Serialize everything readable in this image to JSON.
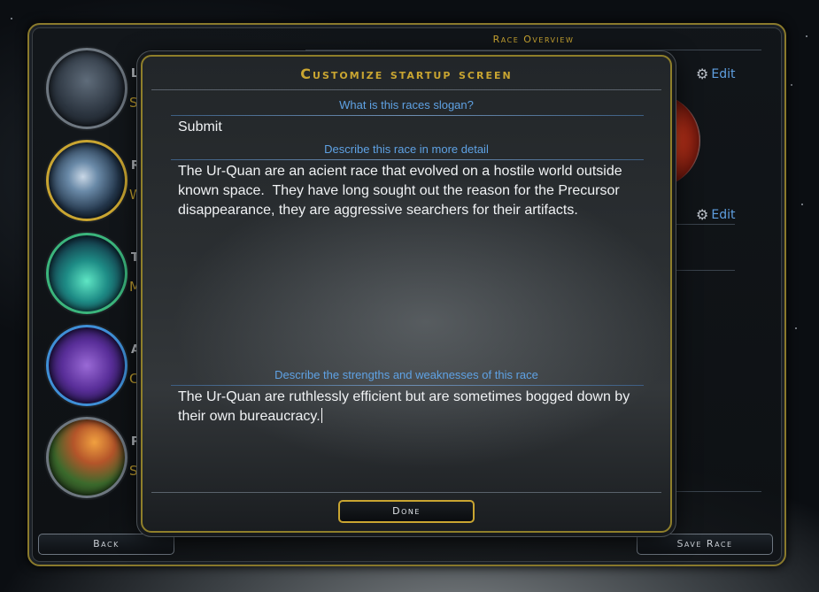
{
  "overview": {
    "title": "Race Overview",
    "edit_label_1": "Edit",
    "edit_label_2": "Edit"
  },
  "sidebar": {
    "items": [
      {
        "letter": "Le",
        "subtext": "Se",
        "icon": "leader-portrait-icon"
      },
      {
        "letter": "R",
        "subtext": "W",
        "icon": "race-planet-icon"
      },
      {
        "letter": "T",
        "subtext": "M",
        "icon": "technology-flask-icon"
      },
      {
        "letter": "A",
        "subtext": "Cl",
        "icon": "ships-icon"
      },
      {
        "letter": "P",
        "subtext": "Se",
        "icon": "homeworld-planet-icon"
      }
    ]
  },
  "dialog": {
    "title": "Customize startup screen",
    "slogan_label": "What is this races slogan?",
    "slogan_value": "Submit",
    "detail_label": "Describe this race in more detail",
    "detail_value": "The Ur-Quan are an acient race that evolved on a hostile world outside known space.  They have long sought out the reason for the Precursor disappearance, they are aggressive searchers for their artifacts.",
    "strengths_label": "Describe the strengths and weaknesses of this race",
    "strengths_value": "The Ur-Quan are ruthlessly efficient but are sometimes bogged down by their own bureaucracy.",
    "done_label": "Done"
  },
  "footer": {
    "back_label": "Back",
    "save_label": "Save Race"
  },
  "colors": {
    "accent_gold": "#c9a531",
    "label_blue": "#5fa2e4"
  }
}
